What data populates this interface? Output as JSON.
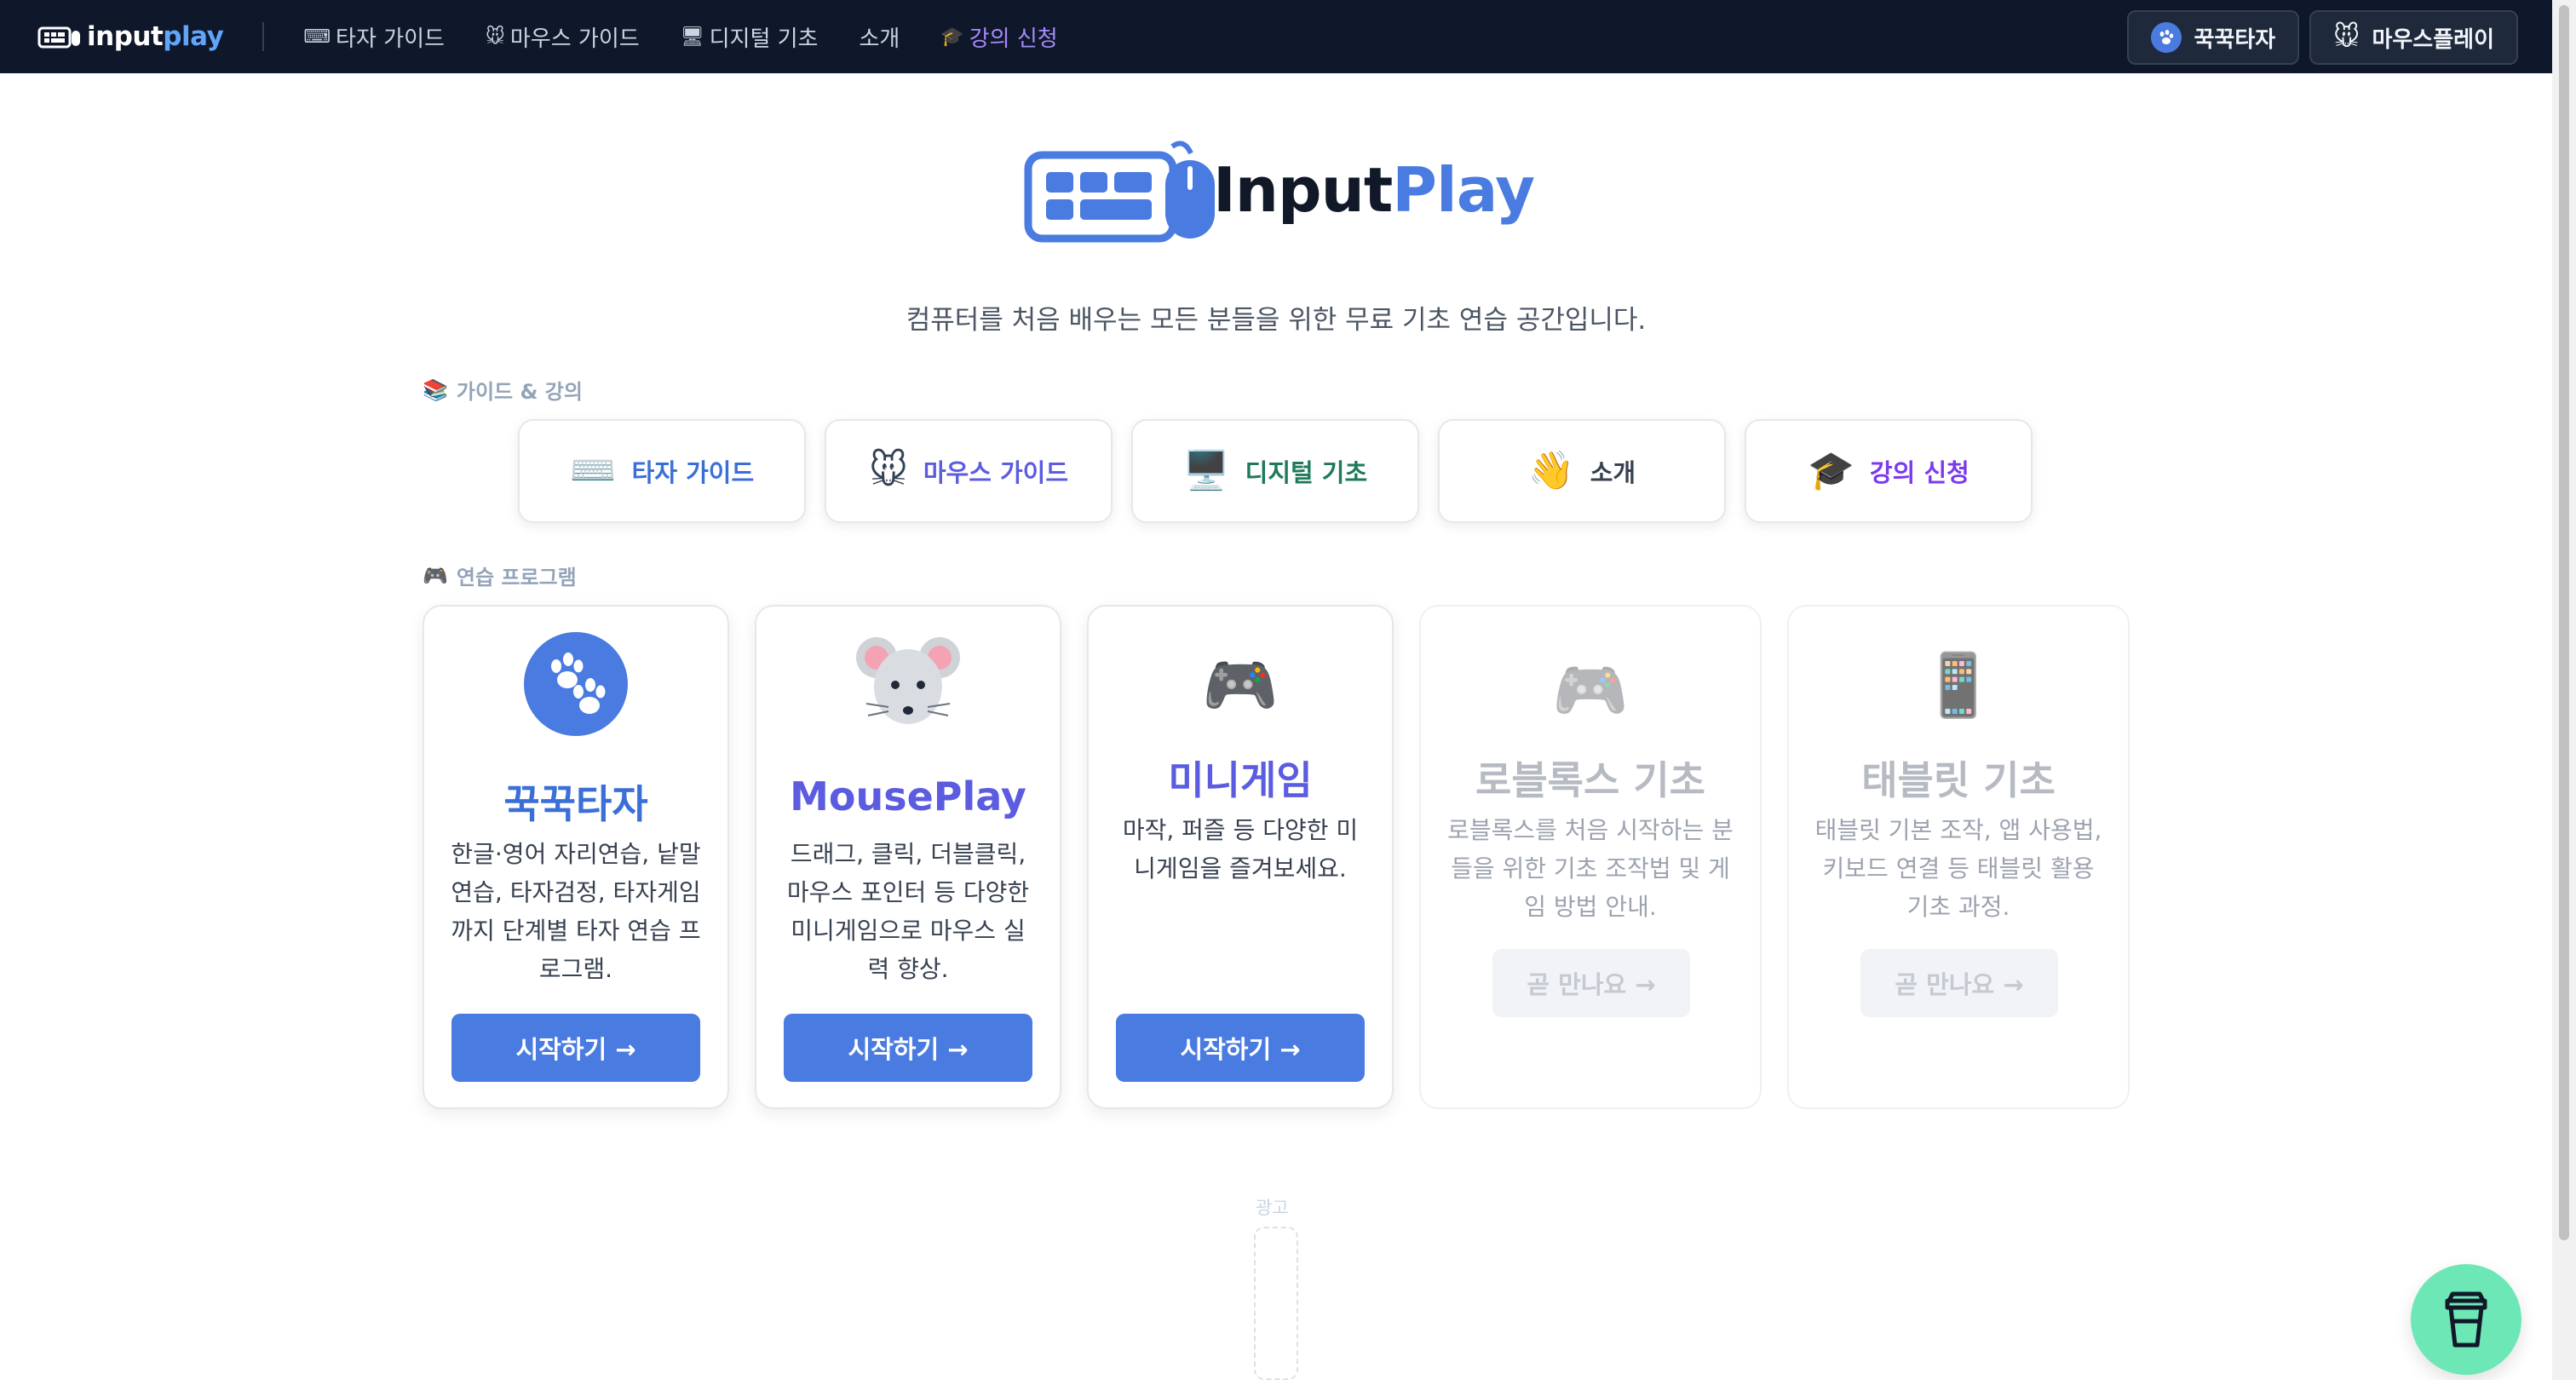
{
  "nav": {
    "brand_part1": "input",
    "brand_part2": "play",
    "links": [
      {
        "icon": "⌨",
        "label": "타자 가이드"
      },
      {
        "icon": "🐭",
        "label": "마우스 가이드"
      },
      {
        "icon": "🖥",
        "label": "디지털 기초"
      },
      {
        "icon": "",
        "label": "소개"
      },
      {
        "icon": "🎓",
        "label": "강의 신청"
      }
    ],
    "buttons": [
      {
        "label": "꾹꾹타자"
      },
      {
        "label": "마우스플레이"
      }
    ]
  },
  "hero": {
    "wordmark_part1": "Input",
    "wordmark_part2": "Play",
    "tagline": "컴퓨터를 처음 배우는 모든 분들을 위한 무료 기초 연습 공간입니다."
  },
  "guides_section": {
    "icon": "📚",
    "title": "가이드 & 강의",
    "cards": [
      {
        "icon": "⌨️",
        "label": "타자 가이드",
        "color": "#3b6fd8"
      },
      {
        "icon": "🐭",
        "label": "마우스 가이드",
        "color": "#5b5ce0"
      },
      {
        "icon": "🖥️",
        "label": "디지털 기초",
        "color": "#1f7a5a"
      },
      {
        "icon": "👋",
        "label": "소개",
        "color": "#374151"
      },
      {
        "icon": "🎓",
        "label": "강의 신청",
        "color": "#7c3aed"
      }
    ]
  },
  "programs_section": {
    "icon": "🎮",
    "title": "연습 프로그램",
    "cards": [
      {
        "title": "꾹꾹타자",
        "desc": "한글·영어 자리연습, 낱말연습, 타자검정, 타자게임까지 단계별 타자 연습 프로그램.",
        "button": "시작하기 →",
        "color": "#3b6fd8"
      },
      {
        "title": "MousePlay",
        "desc": "드래그, 클릭, 더블클릭, 마우스 포인터 등 다양한 미니게임으로 마우스 실력 향상.",
        "button": "시작하기 →",
        "color": "#5b5ce0"
      },
      {
        "icon": "🎮",
        "title": "미니게임",
        "desc": "마작, 퍼즐 등 다양한 미니게임을 즐겨보세요.",
        "button": "시작하기 →",
        "color": "#5b5ce0"
      },
      {
        "icon": "🎮",
        "title": "로블록스 기초",
        "desc": "로블록스를 처음 시작하는 분들을 위한 기초 조작법 및 게임 방법 안내.",
        "button": "곧 만나요 →",
        "color": "#b6bac2"
      },
      {
        "icon": "📱",
        "title": "태블릿 기초",
        "desc": "태블릿 기본 조작, 앱 사용법, 키보드 연결 등 태블릿 활용 기초 과정.",
        "button": "곧 만나요 →",
        "color": "#b6bac2"
      }
    ]
  },
  "ad": {
    "label": "광고"
  },
  "colors": {
    "nav_bg": "#0f172a",
    "accent": "#4a7be0",
    "fab": "#6ee7b7"
  }
}
